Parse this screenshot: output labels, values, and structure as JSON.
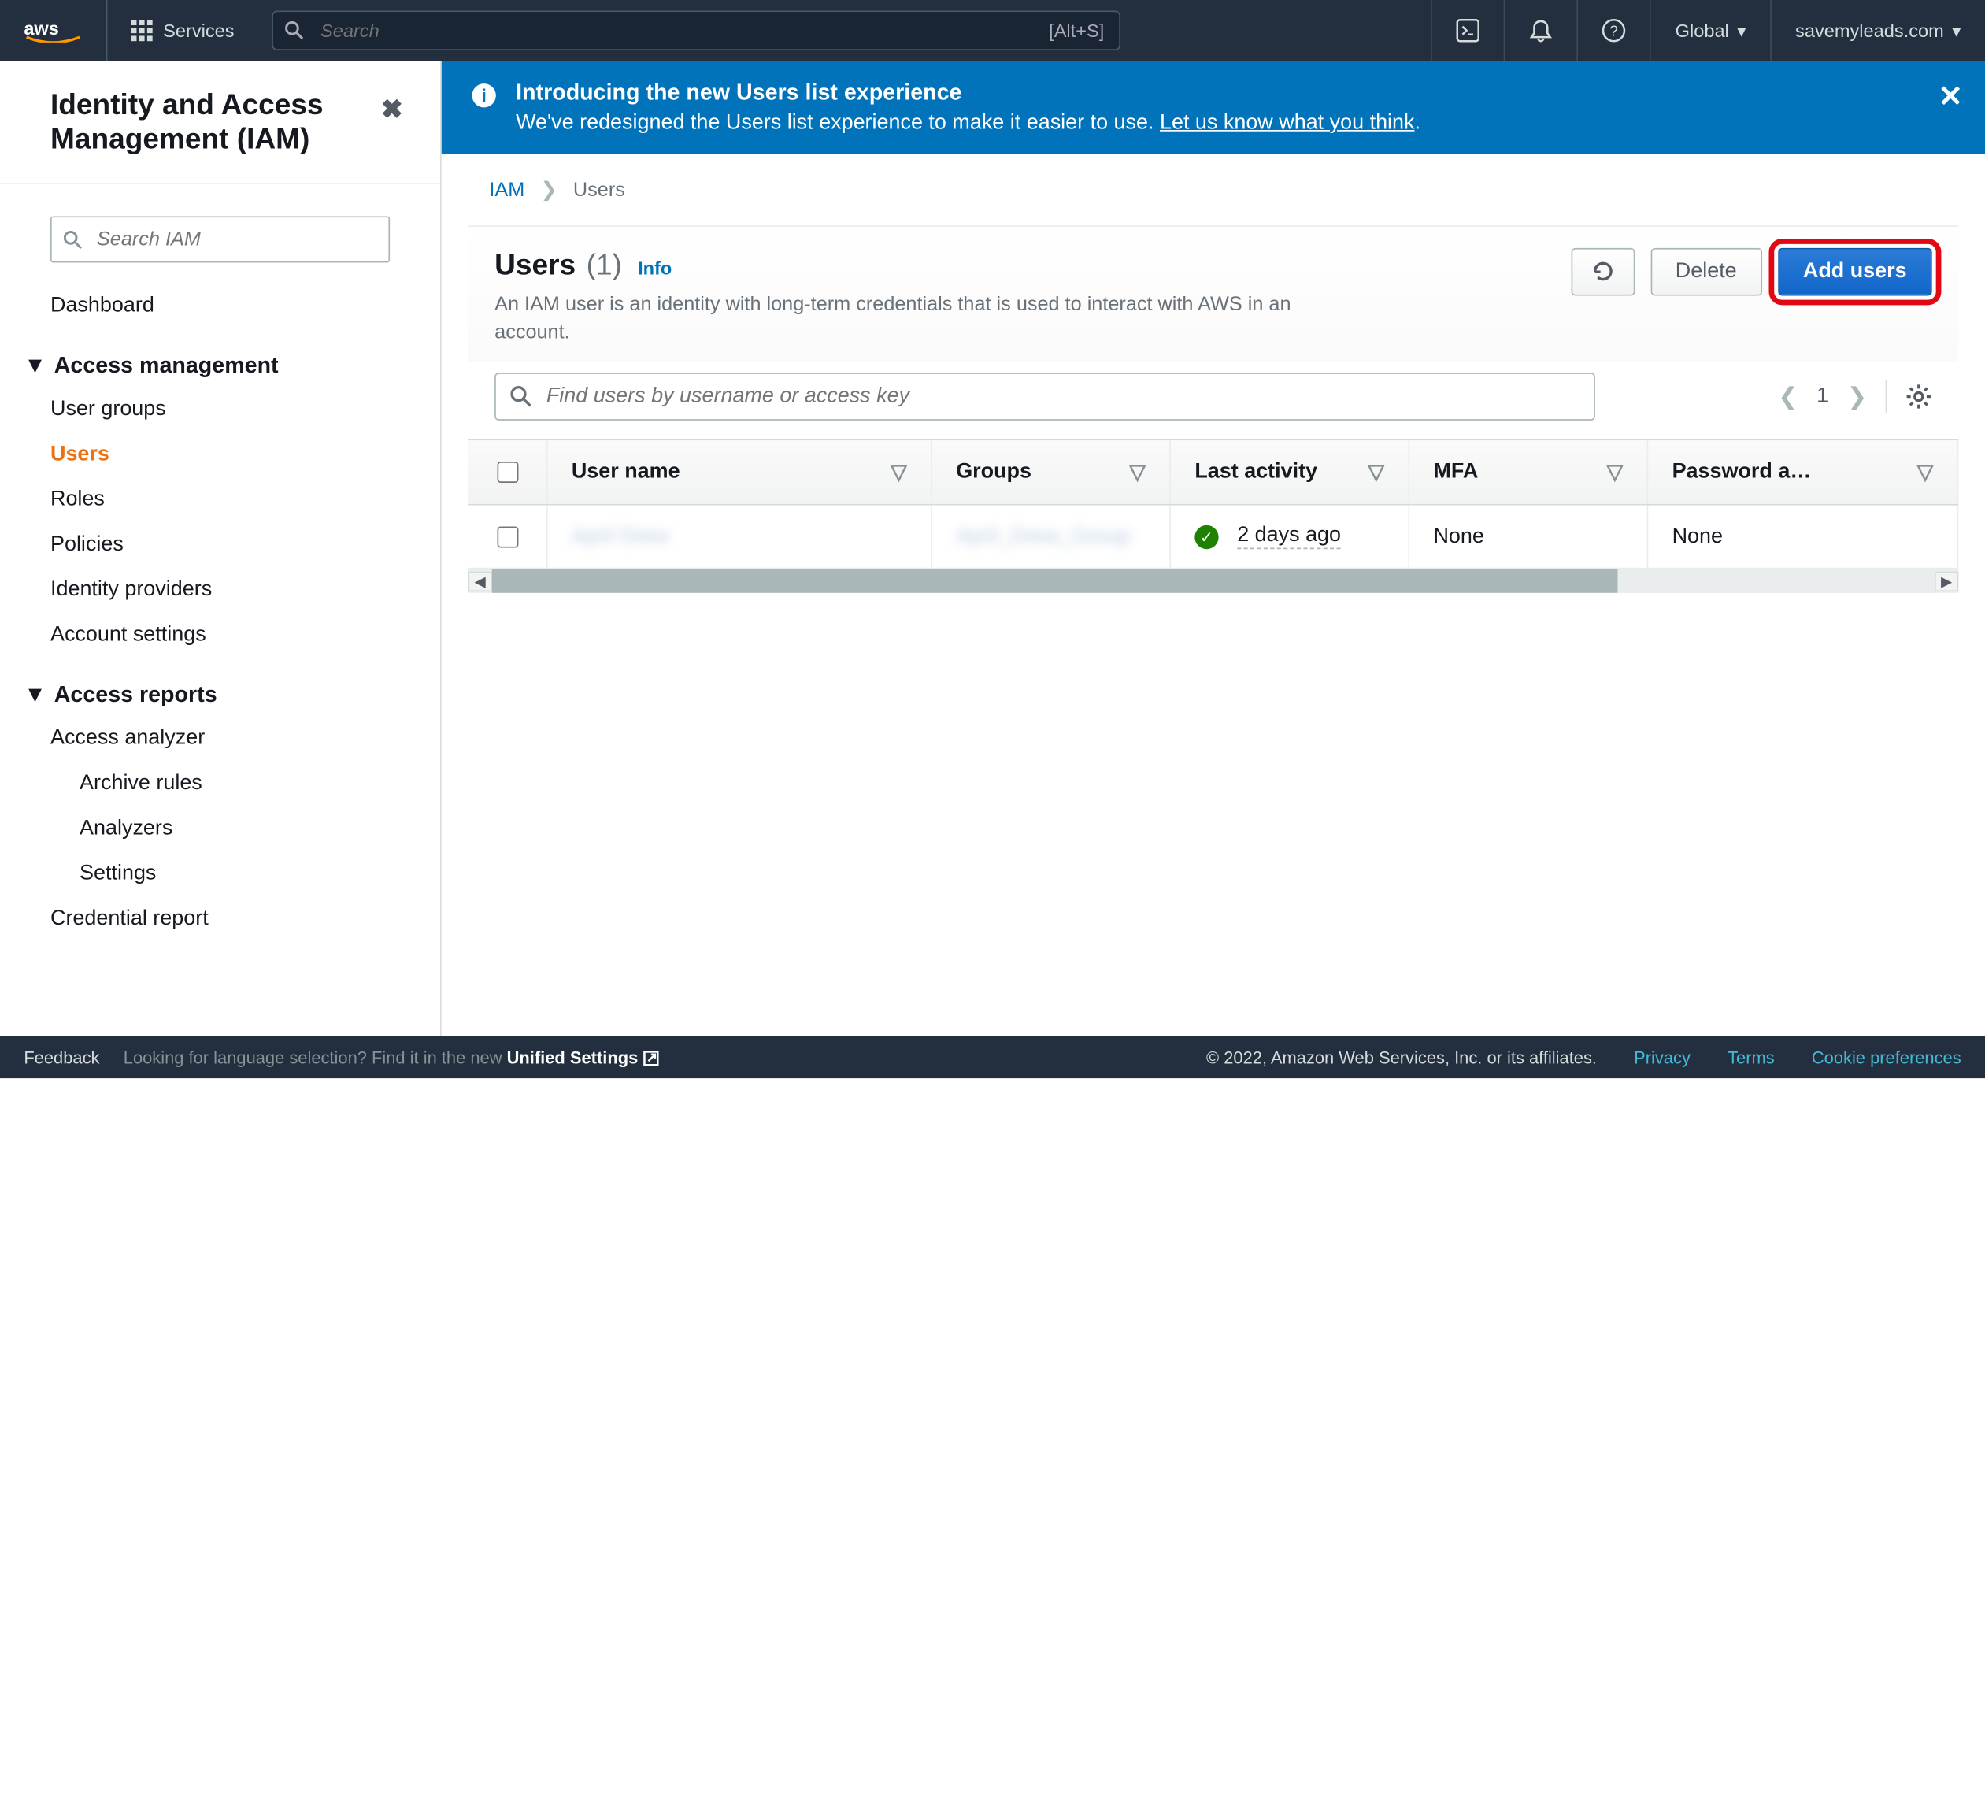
{
  "topnav": {
    "services": "Services",
    "search_placeholder": "Search",
    "search_shortcut": "[Alt+S]",
    "region": "Global",
    "account": "savemyleads.com"
  },
  "banner": {
    "title": "Introducing the new Users list experience",
    "subtitle_prefix": "We've redesigned the Users list experience to make it easier to use. ",
    "subtitle_link": "Let us know what you think"
  },
  "sidebar": {
    "title": "Identity and Access Management (IAM)",
    "search_placeholder": "Search IAM",
    "dashboard": "Dashboard",
    "section_access": "Access management",
    "items_access": [
      "User groups",
      "Users",
      "Roles",
      "Policies",
      "Identity providers",
      "Account settings"
    ],
    "section_reports": "Access reports",
    "items_reports": [
      "Access analyzer"
    ],
    "items_reports_sub": [
      "Archive rules",
      "Analyzers",
      "Settings"
    ],
    "credential": "Credential report"
  },
  "breadcrumb": {
    "root": "IAM",
    "current": "Users"
  },
  "panel": {
    "title": "Users",
    "count": "(1)",
    "info": "Info",
    "desc": "An IAM user is an identity with long-term credentials that is used to interact with AWS in an account.",
    "refresh": "",
    "delete": "Delete",
    "add": "Add users",
    "filter_placeholder": "Find users by username or access key",
    "page": "1"
  },
  "table": {
    "columns": [
      "User name",
      "Groups",
      "Last activity",
      "MFA",
      "Password a…"
    ],
    "row": {
      "user": "April Drew",
      "groups": "April_Drew_Group",
      "last": "2 days ago",
      "mfa": "None",
      "pw": "None"
    }
  },
  "footer": {
    "feedback": "Feedback",
    "lang_prefix": "Looking for language selection? Find it in the new ",
    "lang_link": "Unified Settings",
    "copyright": "© 2022, Amazon Web Services, Inc. or its affiliates.",
    "privacy": "Privacy",
    "terms": "Terms",
    "cookie": "Cookie preferences"
  }
}
